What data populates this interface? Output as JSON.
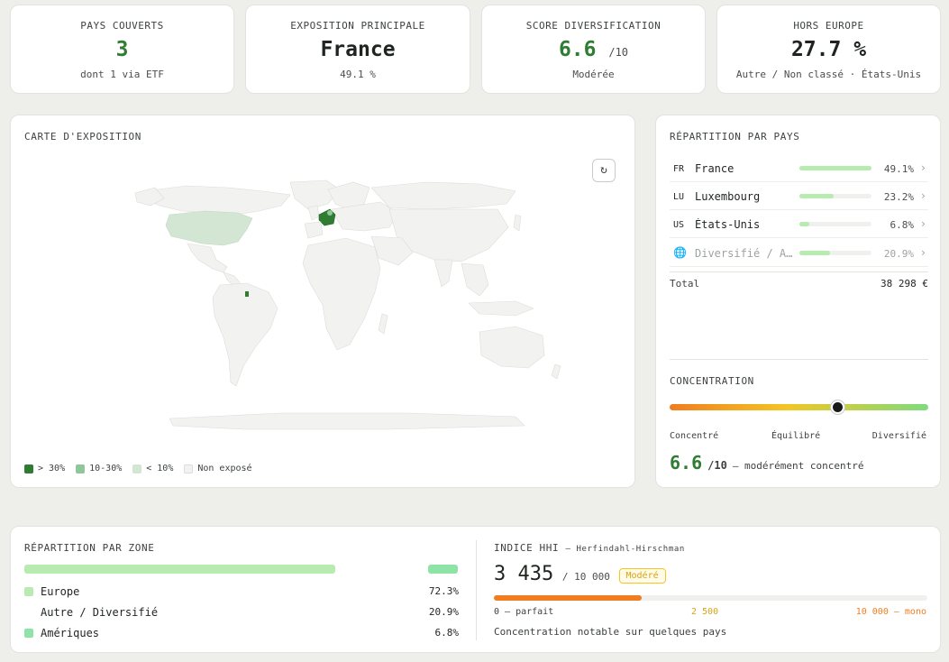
{
  "kpis": [
    {
      "label": "PAYS COUVERTS",
      "value": "3",
      "denom": "",
      "sub": "dont 1 via ETF"
    },
    {
      "label": "EXPOSITION PRINCIPALE",
      "value": "France",
      "denom": "",
      "sub": "49.1 %"
    },
    {
      "label": "SCORE DIVERSIFICATION",
      "value": "6.6",
      "denom": "/10",
      "sub": "Modérée"
    },
    {
      "label": "HORS EUROPE",
      "value": "27.7 %",
      "denom": "",
      "sub": "Autre / Non classé · États-Unis"
    }
  ],
  "map": {
    "title": "CARTE D'EXPOSITION",
    "reset_icon": "↻",
    "legend": [
      {
        "label": "> 30%",
        "color": "#2e7d32"
      },
      {
        "label": "10-30%",
        "color": "#8fc79a"
      },
      {
        "label": "< 10%",
        "color": "#d3e6d3"
      },
      {
        "label": "Non exposé",
        "color": "#f2f2f0"
      }
    ]
  },
  "countries": {
    "title": "RÉPARTITION PAR PAYS",
    "rows": [
      {
        "code": "FR",
        "name": "France",
        "pct": "49.1%",
        "value": 49.1
      },
      {
        "code": "LU",
        "name": "Luxembourg",
        "pct": "23.2%",
        "value": 23.2
      },
      {
        "code": "US",
        "name": "États-Unis",
        "pct": "6.8%",
        "value": 6.8
      },
      {
        "code": "",
        "name": "Diversifié / A…",
        "pct": "20.9%",
        "value": 20.9
      }
    ],
    "total_label": "Total",
    "total_value": "38 298 €",
    "chevron": "›"
  },
  "concentration": {
    "title": "CONCENTRATION",
    "left": "Concentré",
    "mid": "Équilibré",
    "right": "Diversifié",
    "score": "6.6",
    "denom": "/10",
    "desc": "— modérément concentré",
    "position": 0.66
  },
  "zones": {
    "title": "RÉPARTITION PAR ZONE",
    "rows": [
      {
        "name": "Europe",
        "pct": "72.3%",
        "value": 72.3,
        "color": "#b8ebb0"
      },
      {
        "name": "Autre / Diversifié",
        "pct": "20.9%",
        "value": 20.9,
        "color": "#ffffff"
      },
      {
        "name": "Amériques",
        "pct": "6.8%",
        "value": 6.8,
        "color": "#8ee3a6"
      }
    ]
  },
  "hhi": {
    "title": "INDICE HHI",
    "subtitle": "— Herfindahl-Hirschman",
    "value": "3 435",
    "max": "/ 10 000",
    "badge": "Modéré",
    "fraction": 0.3435,
    "scale_left": "0 — parfait",
    "scale_mid": "2 500",
    "scale_right": "10 000 — mono",
    "note": "Concentration notable sur quelques pays"
  }
}
